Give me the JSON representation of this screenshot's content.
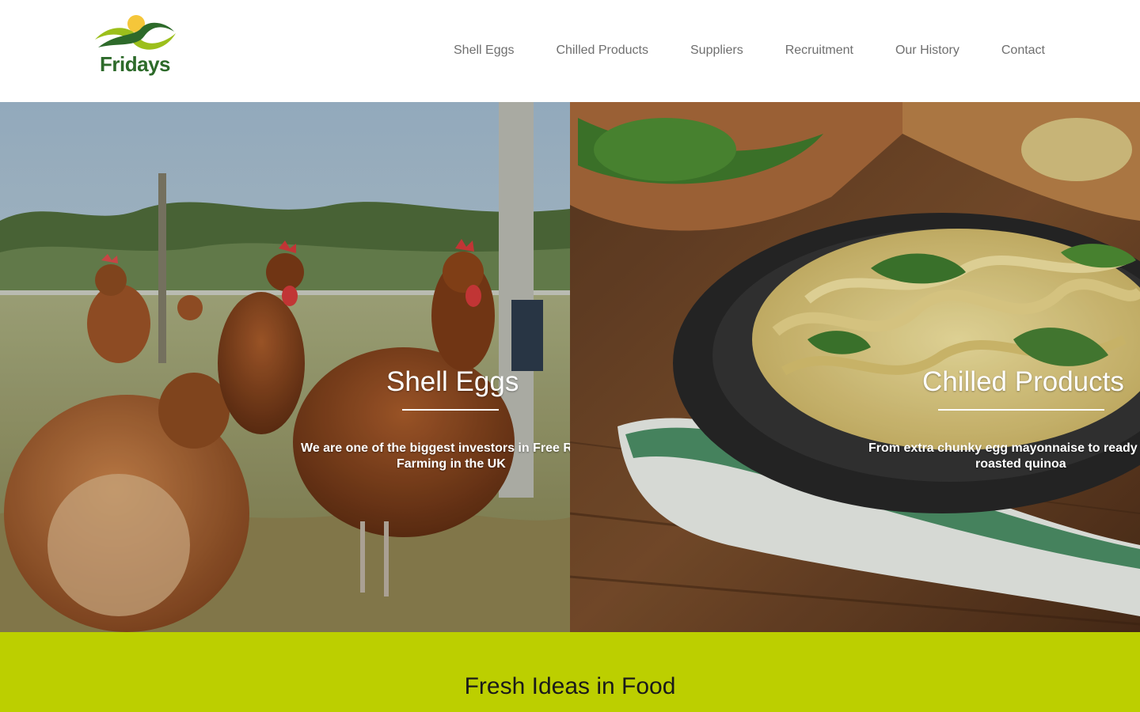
{
  "brand": {
    "name": "Fridays",
    "colors": {
      "green": "#2d6a2a",
      "lime": "#9cbf1b",
      "yellow": "#f5c63a",
      "band": "#bccf00"
    }
  },
  "nav": {
    "items": [
      {
        "label": "Shell Eggs"
      },
      {
        "label": "Chilled Products"
      },
      {
        "label": "Suppliers"
      },
      {
        "label": "Recruitment"
      },
      {
        "label": "Our History"
      },
      {
        "label": "Contact"
      }
    ]
  },
  "hero": {
    "left": {
      "title": "Shell Eggs",
      "line1": "We are one of the biggest investors in Free R",
      "line2": "Farming in the UK",
      "image": "hens-in-field-photo"
    },
    "right": {
      "title": "Chilled Products",
      "line1": "From extra chunky egg mayonnaise to ready",
      "line2": "roasted quinoa",
      "image": "pasta-plate-photo"
    }
  },
  "band": {
    "title": "Fresh Ideas in Food"
  }
}
